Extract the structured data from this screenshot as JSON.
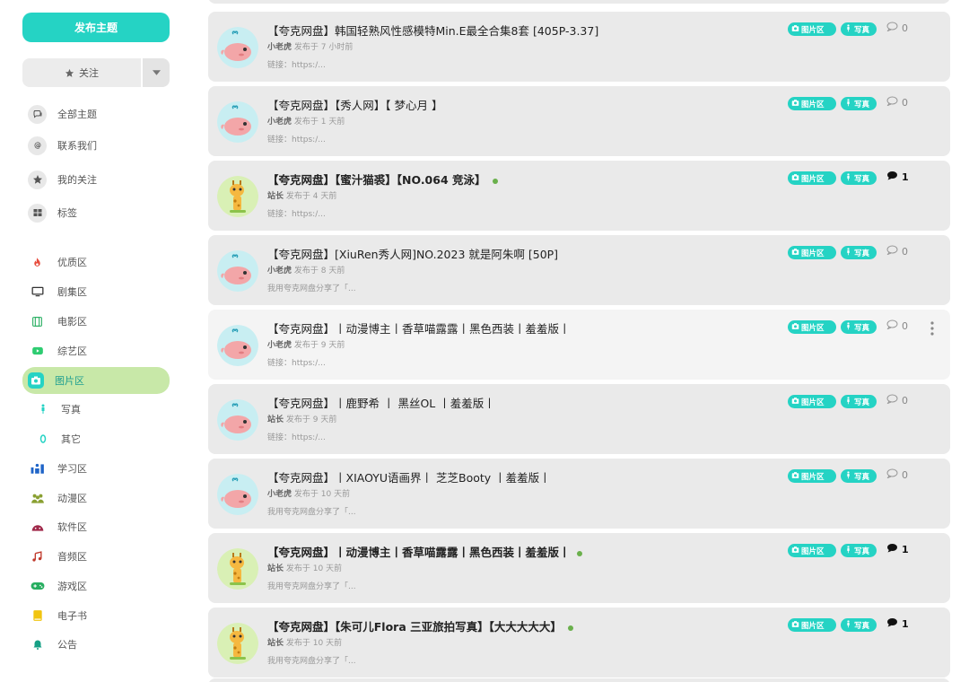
{
  "sidebar": {
    "start_topic": "发布主题",
    "follow": "关注",
    "nav": [
      {
        "label": "全部主题",
        "icon": "chat-icon"
      },
      {
        "label": "联系我们",
        "icon": "at-icon"
      },
      {
        "label": "我的关注",
        "icon": "star-icon"
      },
      {
        "label": "标签",
        "icon": "grid-icon"
      }
    ],
    "categories": [
      {
        "label": "优质区",
        "icon": "flame-icon",
        "color": "#e74c3c"
      },
      {
        "label": "剧集区",
        "icon": "monitor-icon",
        "color": "#333333"
      },
      {
        "label": "电影区",
        "icon": "film-icon",
        "color": "#27ae60"
      },
      {
        "label": "综艺区",
        "icon": "youtube-icon",
        "color": "#2ecc71"
      },
      {
        "label": "图片区",
        "icon": "camera-icon",
        "color": "#25d3c4"
      },
      {
        "label": "写真",
        "icon": "person-icon",
        "color": "#25d3c4"
      },
      {
        "label": "其它",
        "icon": "zero-icon",
        "color": "#25d3c4"
      },
      {
        "label": "学习区",
        "icon": "studying-icon",
        "color": "#1e64c8"
      },
      {
        "label": "动漫区",
        "icon": "users-icon",
        "color": "#8aa032"
      },
      {
        "label": "软件区",
        "icon": "android-icon",
        "color": "#a0294a"
      },
      {
        "label": "音频区",
        "icon": "music-icon",
        "color": "#c0392b"
      },
      {
        "label": "游戏区",
        "icon": "gamepad-icon",
        "color": "#27ae60"
      },
      {
        "label": "电子书",
        "icon": "book-icon",
        "color": "#f1c40f"
      },
      {
        "label": "公告",
        "icon": "bell-icon",
        "color": "#16a085"
      }
    ]
  },
  "tags": {
    "tag1": "图片区",
    "tag2": "写真"
  },
  "colors": {
    "accent": "#25d3c4",
    "active_bg": "#c8e8a8",
    "card_bg": "#eaeaea",
    "unread_dot": "#6ab04c"
  },
  "posts": [
    {
      "title": "【夸克网盘】韩国轻熟风性感模特Min.E最全合集8套 [405P-3.37]",
      "author": "小老虎",
      "time": "发布于 7 小时前",
      "excerpt": "链接：https:/...",
      "replies": "0",
      "avatar": "whale",
      "bold": false
    },
    {
      "title": "【夸克网盘】【秀人网】【 梦心月 】",
      "author": "小老虎",
      "time": "发布于 1 天前",
      "excerpt": "链接：https:/...",
      "replies": "0",
      "avatar": "whale",
      "bold": false
    },
    {
      "title": "【夸克网盘】【蜜汁猫裘】【NO.064 竞泳】",
      "author": "站长",
      "time": "发布于 4 天前",
      "excerpt": "链接：https:/...",
      "replies": "1",
      "avatar": "giraffe",
      "bold": true
    },
    {
      "title": "【夸克网盘】[XiuRen秀人网]NO.2023 就是阿朱啊 [50P]",
      "author": "小老虎",
      "time": "发布于 8 天前",
      "excerpt": "我用夸克网盘分享了「...",
      "replies": "0",
      "avatar": "whale",
      "bold": false
    },
    {
      "title": "【夸克网盘】丨动漫博主丨香草喵露露丨黑色西装丨羞羞版丨",
      "author": "小老虎",
      "time": "发布于 9 天前",
      "excerpt": "链接：https:/...",
      "replies": "0",
      "avatar": "whale",
      "bold": false
    },
    {
      "title": "【夸克网盘】丨鹿野希 丨 黑丝OL 丨羞羞版丨",
      "author": "站长",
      "time": "发布于 9 天前",
      "excerpt": "链接：https:/...",
      "replies": "0",
      "avatar": "whale",
      "bold": false
    },
    {
      "title": "【夸克网盘】丨XIAOYU语画界丨 芝芝Booty 丨羞羞版丨",
      "author": "小老虎",
      "time": "发布于 10 天前",
      "excerpt": "我用夸克网盘分享了「...",
      "replies": "0",
      "avatar": "whale",
      "bold": false
    },
    {
      "title": "【夸克网盘】丨动漫博主丨香草喵露露丨黑色西装丨羞羞版丨",
      "author": "站长",
      "time": "发布于 10 天前",
      "excerpt": "我用夸克网盘分享了「...",
      "replies": "1",
      "avatar": "giraffe",
      "bold": true
    },
    {
      "title": "【夸克网盘】【朱可儿Flora 三亚旅拍写真】【大大大大大】",
      "author": "站长",
      "time": "发布于 10 天前",
      "excerpt": "我用夸克网盘分享了「...",
      "replies": "1",
      "avatar": "giraffe",
      "bold": true
    }
  ]
}
